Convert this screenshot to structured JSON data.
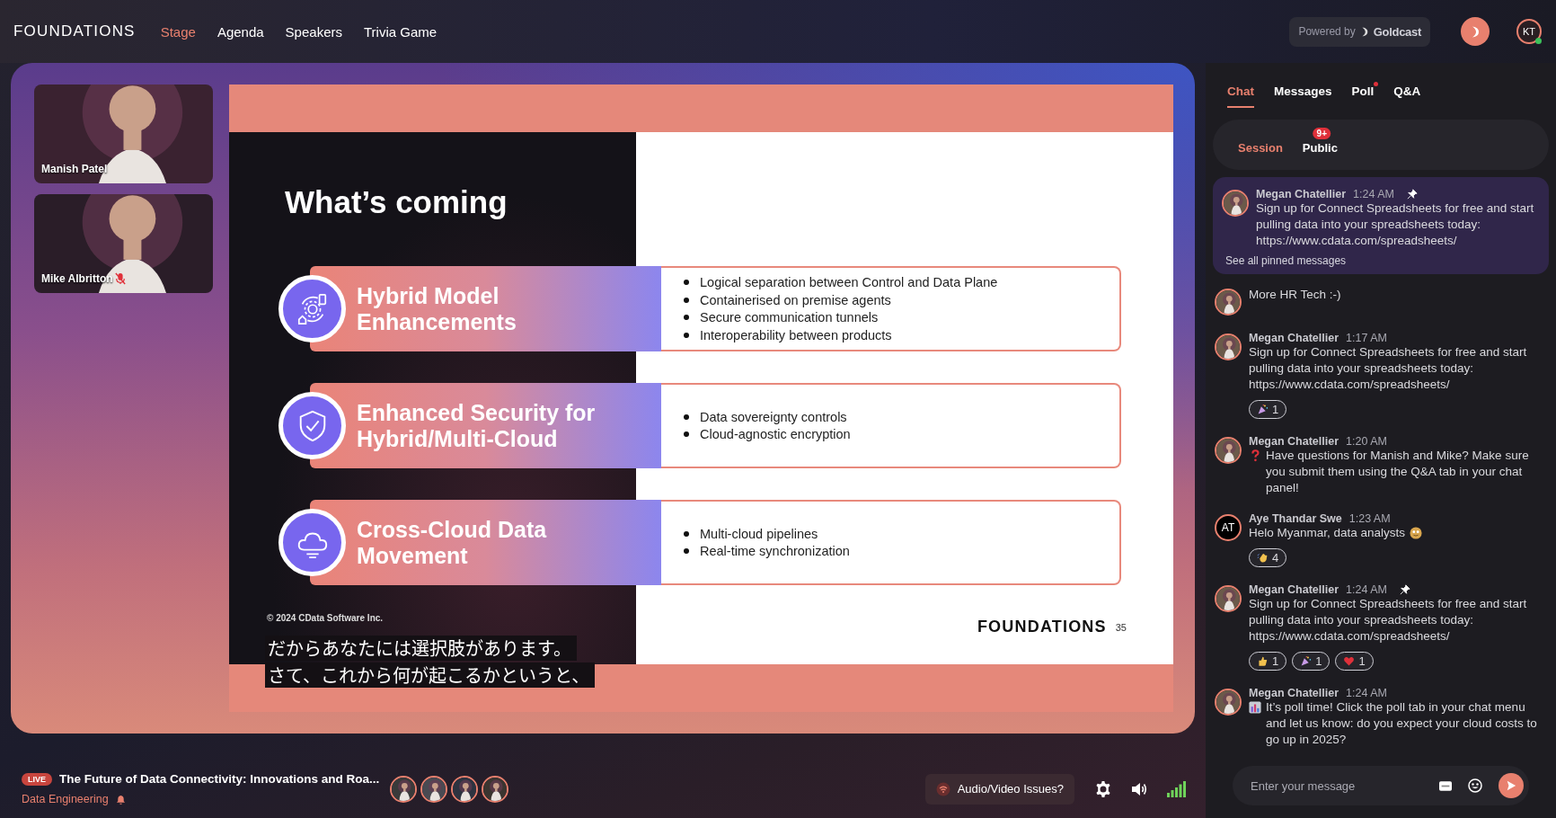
{
  "header": {
    "logo": "FOUNDATIONS",
    "nav": [
      {
        "label": "Stage",
        "selected": true
      },
      {
        "label": "Agenda",
        "selected": false
      },
      {
        "label": "Speakers",
        "selected": false
      },
      {
        "label": "Trivia Game",
        "selected": false
      }
    ],
    "powered_by": "Powered by",
    "brand": "Goldcast",
    "user_initials": "KT",
    "online": true
  },
  "stage": {
    "videos": [
      {
        "name": "Manish Patel",
        "muted": false
      },
      {
        "name": "Mike Albritton",
        "muted": true
      }
    ],
    "slide": {
      "title": "What’s coming",
      "rows": [
        {
          "kind": "hybrid",
          "title": "Hybrid Model Enhancements",
          "bullets": [
            "Logical separation between Control and Data Plane",
            "Containerised on premise agents",
            "Secure communication tunnels",
            "Interoperability between products"
          ]
        },
        {
          "kind": "security",
          "title": "Enhanced Security for Hybrid/Multi-Cloud",
          "bullets": [
            "Data sovereignty controls",
            "Cloud-agnostic encryption"
          ]
        },
        {
          "kind": "cloud",
          "title": "Cross-Cloud Data Movement",
          "bullets": [
            "Multi-cloud pipelines",
            "Real-time synchronization"
          ]
        }
      ],
      "copyright": "© 2024 CData Software Inc.",
      "logo": "FOUNDATIONS",
      "page": "35"
    },
    "subtitles": [
      "だからあなたには選択肢があります。",
      "さて、これから何が起こるかというと、"
    ]
  },
  "bottom_bar": {
    "live": "LIVE",
    "title": "The Future of Data Connectivity: Innovations and Roa...",
    "track": "Data Engineering",
    "issues_button": "Audio/Video Issues?"
  },
  "chat": {
    "tabs": [
      {
        "label": "Chat",
        "selected": true,
        "alert": false
      },
      {
        "label": "Messages",
        "selected": false,
        "alert": false
      },
      {
        "label": "Poll",
        "selected": false,
        "alert": true
      },
      {
        "label": "Q&A",
        "selected": false,
        "alert": false
      }
    ],
    "scopes": [
      {
        "label": "Session",
        "selected": true
      },
      {
        "label": "Public",
        "selected": false,
        "badge": "9+"
      }
    ],
    "pinned": {
      "name": "Megan Chatellier",
      "time": "1:24 AM",
      "pinned": true,
      "text": "Sign up for Connect Spreadsheets for free and start pulling data into your spreadsheets today: https://www.cdata.com/spreadsheets/"
    },
    "see_all": "See all pinned messages",
    "messages": [
      {
        "text": "More HR Tech :-)",
        "pinned": false
      },
      {
        "name": "Megan Chatellier",
        "time": "1:17 AM",
        "pinned": false,
        "text": "Sign up for Connect Spreadsheets for free and start pulling data into your spreadsheets today: https://www.cdata.com/spreadsheets/",
        "reactions": [
          {
            "kind": "party",
            "count": "1"
          }
        ]
      },
      {
        "name": "Megan Chatellier",
        "time": "1:20 AM",
        "pinned": false,
        "lead_icon": {
          "kind": "question"
        },
        "text": "Have questions for Manish and Mike? Make sure you submit them using the Q&A tab in your chat panel!"
      },
      {
        "initials": "AT",
        "name": "Aye Thandar Swe",
        "time": "1:23 AM",
        "pinned": false,
        "text": "Helo Myanmar, data analysts",
        "trail_icon": {
          "kind": "smile"
        },
        "reactions": [
          {
            "kind": "wave",
            "count": "4"
          }
        ]
      },
      {
        "name": "Megan Chatellier",
        "time": "1:24 AM",
        "pinned": true,
        "text": "Sign up for Connect Spreadsheets for free and start pulling data into your spreadsheets today: https://www.cdata.com/spreadsheets/",
        "reactions": [
          {
            "kind": "thumbs",
            "count": "1"
          },
          {
            "kind": "party",
            "count": "1"
          },
          {
            "kind": "heart",
            "count": "1"
          }
        ]
      },
      {
        "name": "Megan Chatellier",
        "time": "1:24 AM",
        "pinned": false,
        "lead_icon": {
          "kind": "chart"
        },
        "text": "It’s poll time! Click the poll tab in your chat menu and let us know: do you expect your cloud costs to go up in 2025?"
      }
    ],
    "input": {
      "placeholder": "Enter your message"
    }
  }
}
